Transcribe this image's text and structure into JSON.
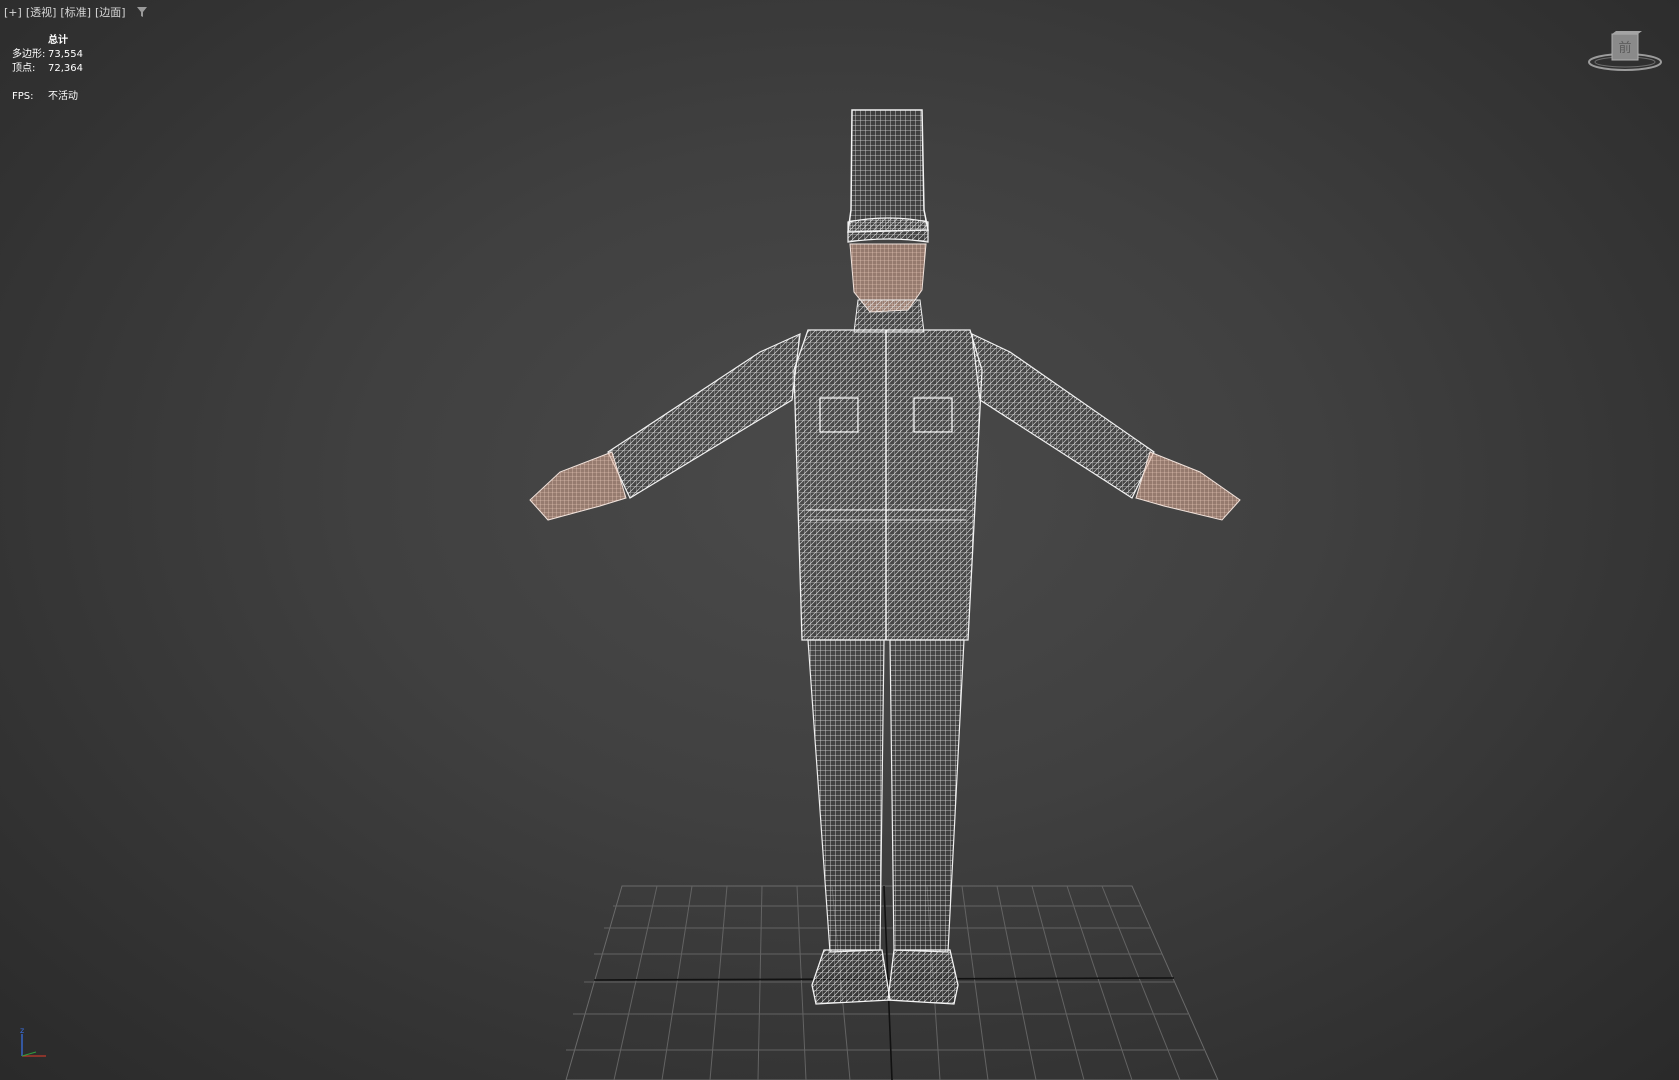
{
  "viewport": {
    "label_plus": "[+]",
    "label_view": "[透视]",
    "label_shading": "[标准]",
    "label_mode": "[边面]",
    "filter_icon": "funnel-icon"
  },
  "stats": {
    "header": "总计",
    "polys_label": "多边形:",
    "polys_value": "73,554",
    "verts_label": "顶点:",
    "verts_value": "72,364",
    "fps_label": "FPS:",
    "fps_value": "不活动"
  },
  "viewcube": {
    "face_label": "前",
    "icon": "viewcube-icon"
  },
  "axis": {
    "z_label": "z",
    "icon": "axis-tripod-icon"
  },
  "colors": {
    "wire": "#e8e8e8",
    "skin": "#e9b9a2",
    "grid": "#6a6a6a",
    "grid_axis": "#111111"
  }
}
